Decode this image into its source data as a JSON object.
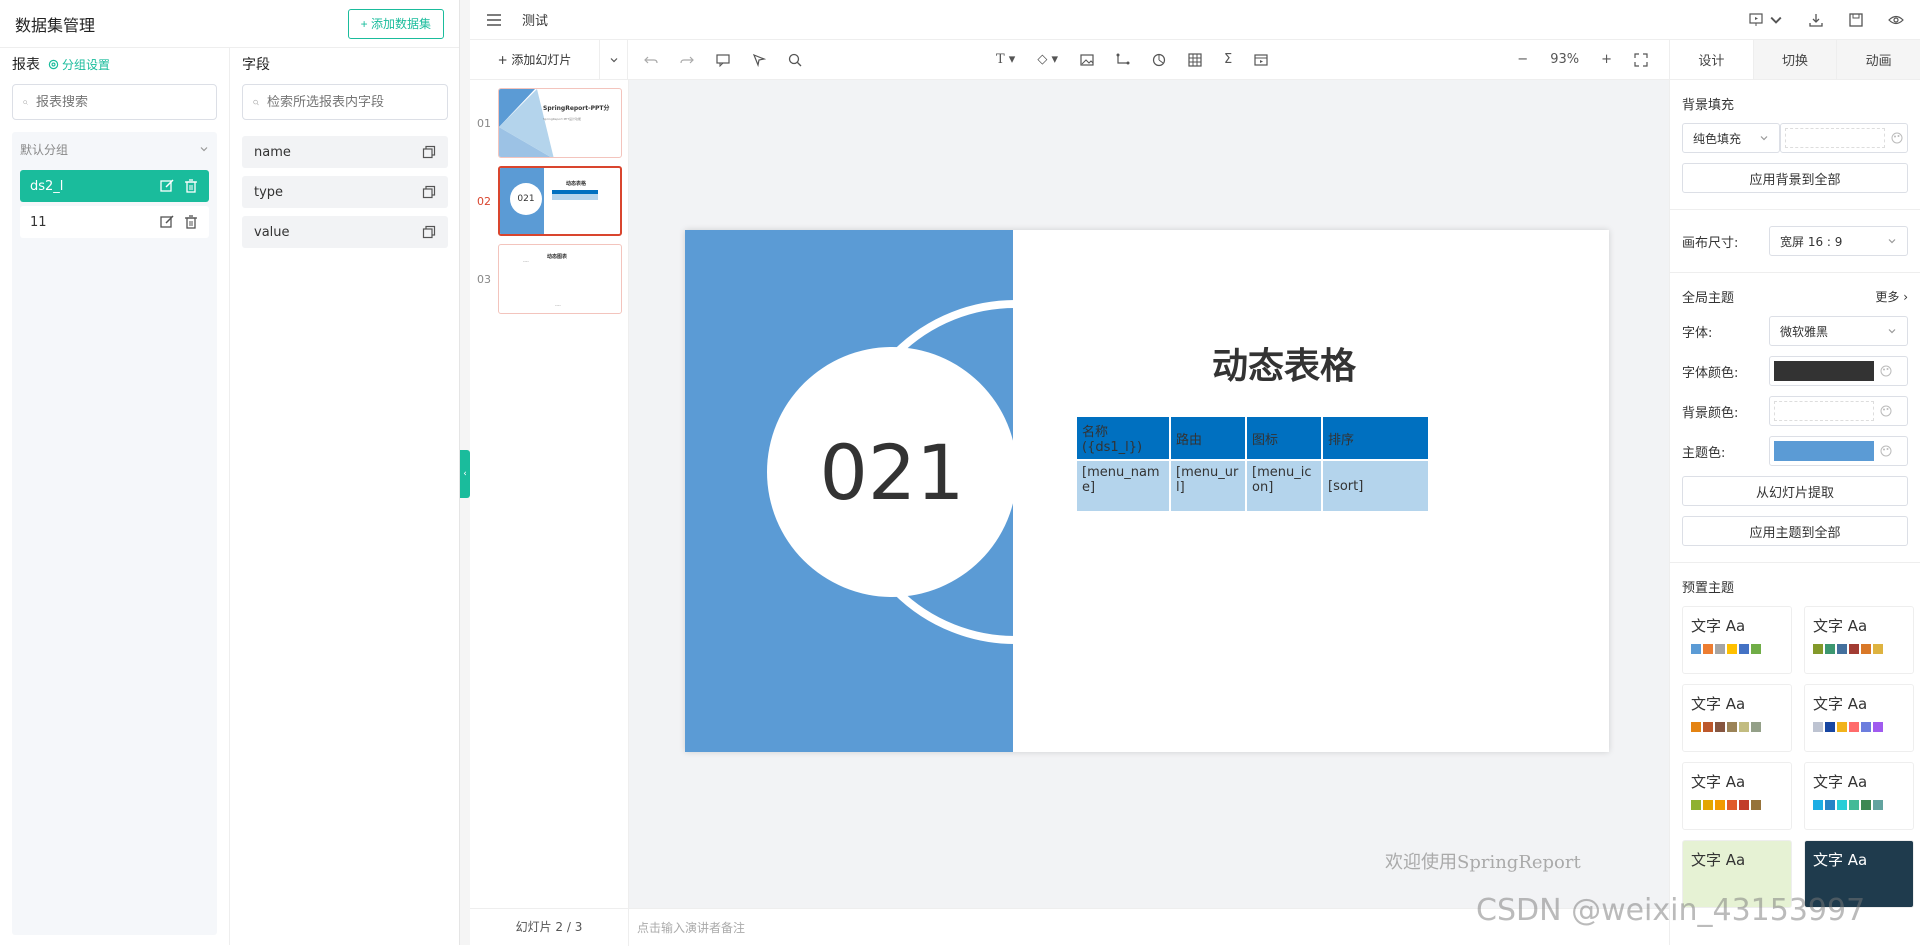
{
  "left": {
    "title": "数据集管理",
    "add_btn": "+ 添加数据集",
    "report_header": "报表",
    "group_setting": "分组设置",
    "report_search_placeholder": "报表搜索",
    "group_name": "默认分组",
    "datasets": [
      {
        "name": "ds2_l",
        "active": true
      },
      {
        "name": "11",
        "active": false
      }
    ],
    "field_header": "字段",
    "field_search_placeholder": "检索所选报表内字段",
    "fields": [
      "name",
      "type",
      "value"
    ]
  },
  "topbar": {
    "title": "测试"
  },
  "toolbar": {
    "add_slide": "+ 添加幻灯片",
    "zoom": "93%"
  },
  "thumbs": [
    {
      "num": "01",
      "title": "SpringReport-PPT分",
      "sub": "SpringReport PPT设计功能"
    },
    {
      "num": "02",
      "title": "动态表格",
      "circle": "021"
    },
    {
      "num": "03",
      "title": "动态图表",
      "sub": "----",
      "sub2": "----"
    }
  ],
  "slide": {
    "number": "021",
    "title": "动态表格",
    "table": {
      "headers": [
        "名称({ds1_l})",
        "路由",
        "图标",
        "排序"
      ],
      "row": [
        "[menu_name]",
        "[menu_url]",
        "[menu_icon]",
        "[sort]"
      ]
    },
    "watermark": "欢迎使用SpringReport"
  },
  "bottom": {
    "counter": "幻灯片 2 / 3",
    "notes_placeholder": "点击输入演讲者备注"
  },
  "rpanel": {
    "tabs": [
      "设计",
      "切换",
      "动画"
    ],
    "bg_fill": "背景填充",
    "fill_type": "纯色填充",
    "apply_bg_all": "应用背景到全部",
    "canvas_size_label": "画布尺寸:",
    "canvas_size": "宽屏 16 : 9",
    "global_theme": "全局主题",
    "more": "更多",
    "font_label": "字体:",
    "font_value": "微软雅黑",
    "font_color_label": "字体颜色:",
    "bg_color_label": "背景颜色:",
    "theme_color_label": "主题色:",
    "extract_btn": "从幻灯片提取",
    "apply_theme_all": "应用主题到全部",
    "preset_themes": "预置主题",
    "theme_text": "文字 Aa",
    "font_color": "#333333",
    "theme_color": "#5b9bd5"
  },
  "colors": {
    "accent": "#1abc9c",
    "slide_blue": "#5b9bd5",
    "table_header": "#0070c0",
    "table_body": "#b4d4ec",
    "active_red": "#d9452e"
  },
  "csdn_watermark": "CSDN @weixin_43153997"
}
